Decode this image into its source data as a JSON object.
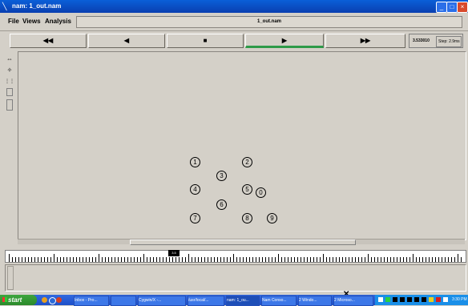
{
  "window": {
    "title": "nam: 1_out.nam",
    "controls": [
      "minimize-icon",
      "maximize-icon",
      "close-icon"
    ]
  },
  "menu": {
    "items": [
      "File",
      "Views",
      "Analysis"
    ],
    "filename": "1_out.nam"
  },
  "playback": {
    "rewind": "◀◀",
    "back": "◀",
    "stop": "■",
    "play": "▶",
    "fast_forward": "▶▶",
    "time": "3.533010",
    "step": "Step: 2.9ms"
  },
  "tools": [
    "zoom-in-icon",
    "zoom-out-icon",
    "tool-3-icon",
    "tool-4-icon",
    "tool-5-icon"
  ],
  "nodes": [
    "1",
    "2",
    "3",
    "4",
    "5",
    "0",
    "6",
    "7",
    "8",
    "9"
  ],
  "ruler": {
    "slider_label": "3.5"
  },
  "taskbar": {
    "start": "start",
    "tasks": [
      "Inbox - Pro...",
      "",
      "Cygwin/X -...",
      "/usr/local/...",
      "nam: 1_ou...",
      "Nam Conso...",
      "2 Windo...",
      "2 Microso..."
    ],
    "clock": "3:30 PM"
  },
  "colors": {
    "titlebar": "#0a4fc8",
    "window_bg": "#d4d0c8",
    "play_active": "#2e9a48",
    "taskbar": "#2458d0",
    "start": "#3a9a3a"
  }
}
